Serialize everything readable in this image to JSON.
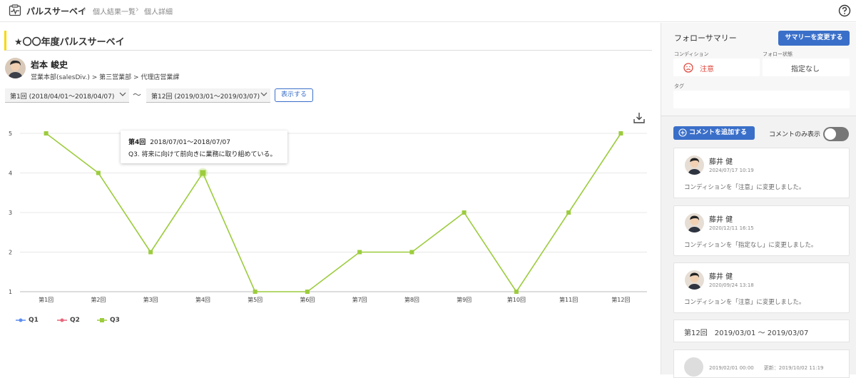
{
  "header": {
    "app_title": "パルスサーベイ",
    "breadcrumbs": [
      "個人結果一覧",
      "個人詳細"
    ]
  },
  "survey": {
    "title": "★〇〇年度パルスサーベイ"
  },
  "person": {
    "name": "岩本 峻史",
    "department": "営業本部(salesDiv.) > 第三営業部 > 代理店営業課"
  },
  "range": {
    "from": "第1回 (2018/04/01〜2018/04/07)",
    "to": "第12回 (2019/03/01〜2019/03/07)",
    "separator": "〜",
    "show_label": "表示する"
  },
  "tooltip": {
    "round": "第4回",
    "dates": "2018/07/01〜2018/07/07",
    "text": "Q3. 将来に向けて前向きに業務に取り組めている。"
  },
  "chart_data": {
    "type": "line",
    "categories": [
      "第1回",
      "第2回",
      "第3回",
      "第4回",
      "第5回",
      "第6回",
      "第7回",
      "第8回",
      "第9回",
      "第10回",
      "第11回",
      "第12回"
    ],
    "yticks": [
      "1",
      "2",
      "3",
      "4",
      "5"
    ],
    "ylim": [
      1,
      5
    ],
    "grid": true,
    "series": [
      {
        "name": "Q1",
        "color": "#5b8def",
        "values": []
      },
      {
        "name": "Q2",
        "color": "#e8667a",
        "values": []
      },
      {
        "name": "Q3",
        "color": "#9ccc3d",
        "values": [
          5,
          4,
          2,
          4,
          1,
          1,
          2,
          2,
          3,
          1,
          3,
          5
        ]
      }
    ],
    "legend": "bottom-left"
  },
  "sidebar": {
    "follow_summary_title": "フォローサマリー",
    "change_summary_label": "サマリーを変更する",
    "condition_label": "コンディション",
    "condition_value": "注意",
    "follow_status_label": "フォロー状態",
    "follow_status_value": "指定なし",
    "tag_label": "タグ",
    "add_comment_label": "コメントを追加する",
    "comment_only_label": "コメントのみ表示",
    "comment_only_on": false,
    "comments": [
      {
        "name": "藤井 健",
        "date": "2024/07/17 10:19",
        "message": "コンディションを「注意」に変更しました。"
      },
      {
        "name": "藤井 健",
        "date": "2020/12/11 16:15",
        "message": "コンディションを「指定なし」に変更しました。"
      },
      {
        "name": "藤井 健",
        "date": "2020/09/24 13:18",
        "message": "コンディションを「注意」に変更しました。"
      }
    ],
    "period_label": "第12回　2019/03/01 〜 2019/03/07",
    "entry_meta": "2019/02/01 00:00　　更新：2019/10/02 11:19"
  }
}
